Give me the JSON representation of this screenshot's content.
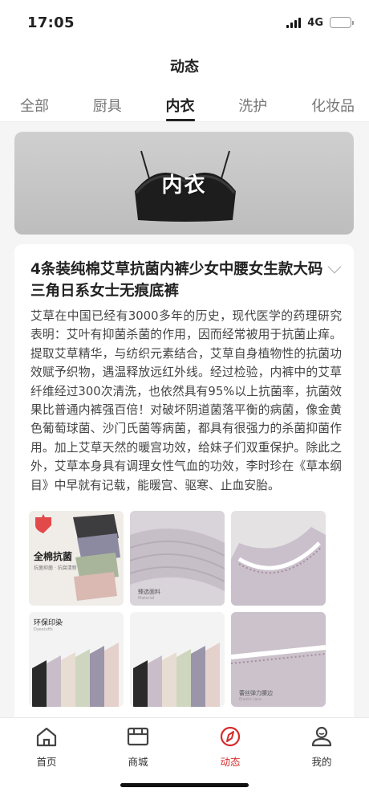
{
  "status_bar": {
    "time": "17:05",
    "network": "4G"
  },
  "header": {
    "title": "动态"
  },
  "tabs": [
    {
      "label": "全部",
      "active": false
    },
    {
      "label": "厨具",
      "active": false
    },
    {
      "label": "内衣",
      "active": true
    },
    {
      "label": "洗护",
      "active": false
    },
    {
      "label": "化妆品",
      "active": false
    }
  ],
  "banner": {
    "label": "内衣"
  },
  "post": {
    "title": "4条装纯棉艾草抗菌内裤少女中腰女生款大码三角日系女士无痕底裤",
    "body": "艾草在中国已经有3000多年的历史，现代医学的药理研究表明：艾叶有抑菌杀菌的作用，因而经常被用于抗菌止痒。提取艾草精华，与纺织元素结合，艾草自身植物性的抗菌功效赋予织物，遇温释放远红外线。经过检验，内裤中的艾草纤维经过300次清洗，也依然具有95%以上抗菌率，抗菌效果比普通内裤强百倍！对破坏阴道菌落平衡的病菌，像金黄色葡萄球菌、沙门氏菌等病菌，都具有很强力的杀菌抑菌作用。加上艾草天然的暖宫功效，给妹子们双重保护。除此之外，艾草本身具有调理女性气血的功效，李时珍在《草本纲目》中早就有记载，能暖宫、驱寒、止血安胎。",
    "images": [
      {
        "caption": "全棉抗菌",
        "sub": "抗菌抑菌 · 抗腐清新"
      },
      {
        "caption": "臻选面料",
        "sub": "Material"
      },
      {
        "caption": "",
        "sub": ""
      },
      {
        "caption": "环保印染",
        "sub": "Dyestuffs"
      },
      {
        "caption": "",
        "sub": ""
      },
      {
        "caption": "蕾丝弹力腰边",
        "sub": "Elastic lace"
      }
    ]
  },
  "tabbar": [
    {
      "label": "首页",
      "icon": "home-icon",
      "active": false
    },
    {
      "label": "商城",
      "icon": "store-icon",
      "active": false
    },
    {
      "label": "动态",
      "icon": "compass-icon",
      "active": true
    },
    {
      "label": "我的",
      "icon": "user-icon",
      "active": false
    }
  ],
  "colors": {
    "accent": "#d62b2b",
    "battery": "#3bc348"
  }
}
